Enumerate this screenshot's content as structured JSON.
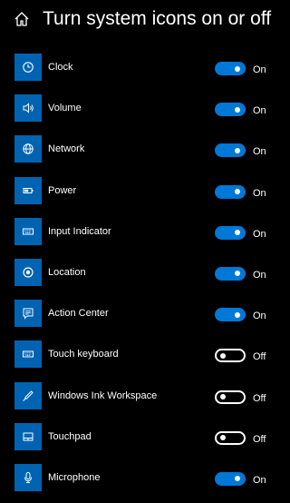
{
  "header": {
    "title": "Turn system icons on or off",
    "home_icon": "home-icon"
  },
  "colors": {
    "background": "#000000",
    "tile": "#0063b1",
    "toggle_on": "#0078d7",
    "toggle_off_border": "#ffffff"
  },
  "items": [
    {
      "label": "Clock",
      "icon": "clock-icon",
      "state": "On",
      "on": true
    },
    {
      "label": "Volume",
      "icon": "volume-icon",
      "state": "On",
      "on": true
    },
    {
      "label": "Network",
      "icon": "network-icon",
      "state": "On",
      "on": true
    },
    {
      "label": "Power",
      "icon": "power-icon",
      "state": "On",
      "on": true
    },
    {
      "label": "Input Indicator",
      "icon": "keyboard-icon",
      "state": "On",
      "on": true
    },
    {
      "label": "Location",
      "icon": "location-icon",
      "state": "On",
      "on": true
    },
    {
      "label": "Action Center",
      "icon": "action-center-icon",
      "state": "On",
      "on": true
    },
    {
      "label": "Touch keyboard",
      "icon": "touch-keyboard-icon",
      "state": "Off",
      "on": false
    },
    {
      "label": "Windows Ink Workspace",
      "icon": "pen-icon",
      "state": "Off",
      "on": false
    },
    {
      "label": "Touchpad",
      "icon": "touchpad-icon",
      "state": "Off",
      "on": false
    },
    {
      "label": "Microphone",
      "icon": "microphone-icon",
      "state": "On",
      "on": true
    }
  ]
}
